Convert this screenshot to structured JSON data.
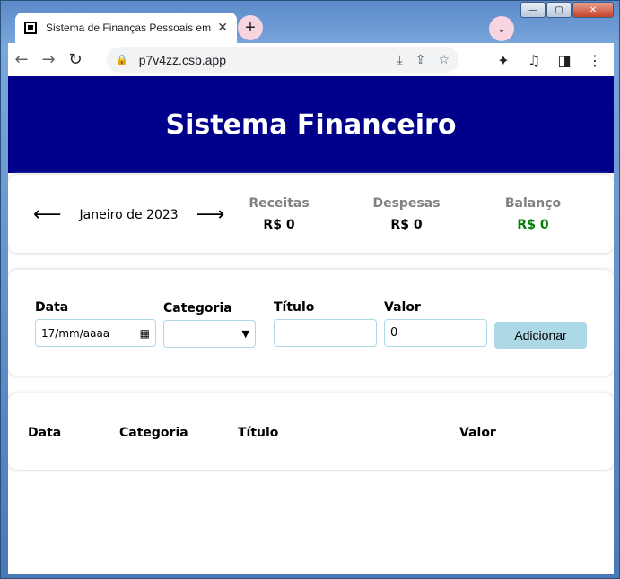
{
  "browser": {
    "tab_title": "Sistema de Finanças Pessoais em",
    "tab_close": "✕",
    "new_tab": "+",
    "tab_search": "⌄",
    "url": "p7v4zz.csb.app"
  },
  "window": {
    "minimize": "—",
    "maximize": "▢",
    "close": "✕"
  },
  "header": {
    "title": "Sistema Financeiro"
  },
  "summary": {
    "prev_arrow": "⟵",
    "next_arrow": "⟶",
    "month": "Janeiro de 2023",
    "income_label": "Receitas",
    "income_value": "R$ 0",
    "expense_label": "Despesas",
    "expense_value": "R$ 0",
    "balance_label": "Balanço",
    "balance_value": "R$ 0",
    "balance_color": "#008000"
  },
  "form": {
    "date_label": "Data",
    "date_value": "17/mm/aaaa",
    "category_label": "Categoria",
    "category_value": "",
    "title_label": "Título",
    "title_value": "",
    "value_label": "Valor",
    "value_value": "0",
    "add_button": "Adicionar"
  },
  "table": {
    "headers": [
      "Data",
      "Categoria",
      "Título",
      "Valor"
    ]
  },
  "colors": {
    "header_bg": "#00008b",
    "button_bg": "#add8e6",
    "label_gray": "#808080"
  }
}
